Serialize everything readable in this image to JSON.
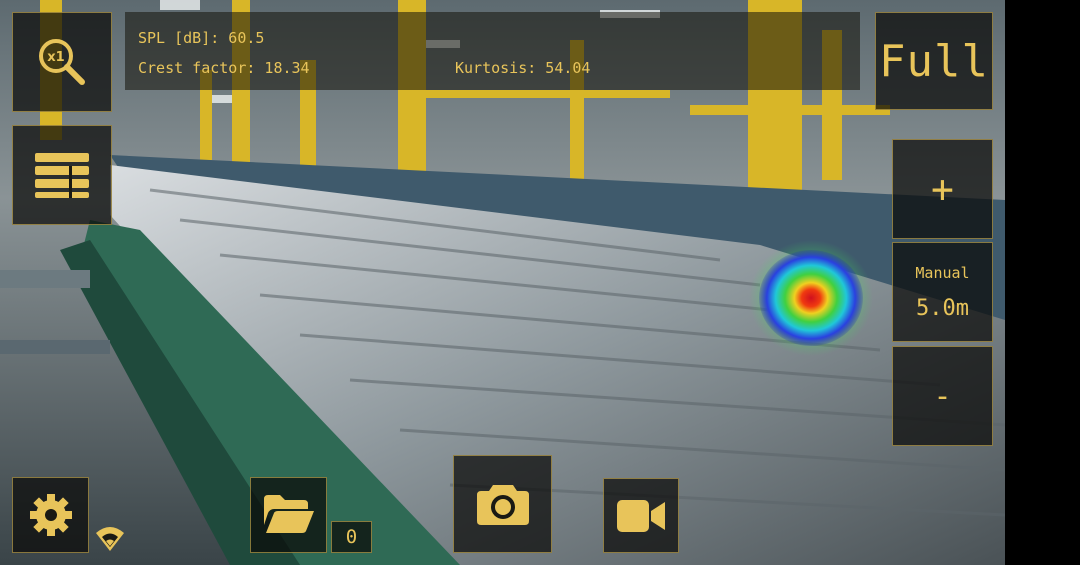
{
  "readout": {
    "spl": "SPL [dB]: 60.5",
    "crest": "Crest factor: 18.34",
    "kurtosis": "Kurtosis: 54.04"
  },
  "controls": {
    "view_mode": "Full",
    "zoom_in": "+",
    "zoom_out": "-",
    "focus_mode": "Manual",
    "distance": "5.0m",
    "zoom_badge": "x1"
  },
  "bottom": {
    "file_count": "0"
  },
  "icons": {
    "zoom": "magnifier-x1-icon",
    "layers": "list-layers-icon",
    "settings": "gear-icon",
    "folder": "folder-open-icon",
    "camera": "camera-icon",
    "video": "video-camera-icon",
    "signal": "wifi-signal-icon"
  },
  "colors": {
    "accent": "#e8c45a",
    "hotspot_core": "#e0102a",
    "hotspot_mid": "#38d03a",
    "hotspot_edge": "#2a2cc8"
  }
}
